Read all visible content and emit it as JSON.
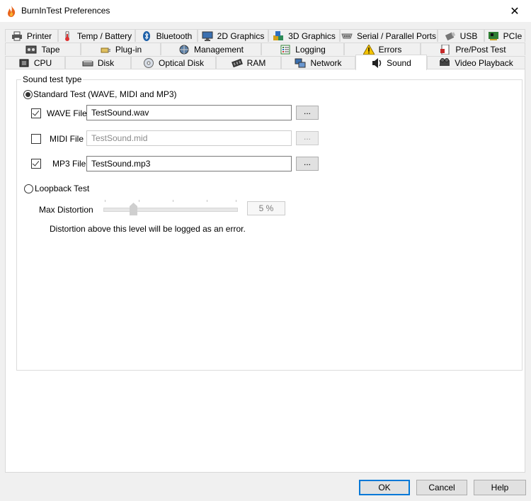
{
  "window": {
    "title": "BurnInTest Preferences",
    "close_glyph": "✕"
  },
  "tabs": {
    "row1": [
      {
        "label": "Printer",
        "icon": "printer-icon"
      },
      {
        "label": "Temp / Battery",
        "icon": "thermometer-icon"
      },
      {
        "label": "Bluetooth",
        "icon": "bluetooth-icon"
      },
      {
        "label": "2D Graphics",
        "icon": "monitor-icon"
      },
      {
        "label": "3D Graphics",
        "icon": "cubes-icon"
      },
      {
        "label": "Serial / Parallel Ports",
        "icon": "port-icon"
      },
      {
        "label": "USB",
        "icon": "usb-icon"
      },
      {
        "label": "PCIe",
        "icon": "pcie-card-icon"
      }
    ],
    "row2": [
      {
        "label": "Tape",
        "icon": "tape-icon"
      },
      {
        "label": "Plug-in",
        "icon": "plugin-icon"
      },
      {
        "label": "Management",
        "icon": "network-globe-icon"
      },
      {
        "label": "Logging",
        "icon": "log-list-icon"
      },
      {
        "label": "Errors",
        "icon": "warning-icon"
      },
      {
        "label": "Pre/Post Test",
        "icon": "document-icon"
      }
    ],
    "row3": [
      {
        "label": "CPU",
        "icon": "cpu-icon"
      },
      {
        "label": "Disk",
        "icon": "disk-drive-icon"
      },
      {
        "label": "Optical Disk",
        "icon": "optical-disk-icon"
      },
      {
        "label": "RAM",
        "icon": "ram-icon"
      },
      {
        "label": "Network",
        "icon": "network-icon"
      },
      {
        "label": "Sound",
        "icon": "speaker-icon",
        "active": true
      },
      {
        "label": "Video Playback",
        "icon": "film-icon"
      }
    ]
  },
  "sound": {
    "group_title": "Sound test type",
    "standard_label": "Standard Test (WAVE, MIDI and MP3)",
    "standard_selected": true,
    "wave": {
      "label": "WAVE File",
      "checked": true,
      "value": "TestSound.wav",
      "browse": "..."
    },
    "midi": {
      "label": "MIDI File",
      "checked": false,
      "value": "TestSound.mid",
      "browse": "...",
      "disabled": true
    },
    "mp3": {
      "label": "MP3 File",
      "checked": true,
      "value": "TestSound.mp3",
      "browse": "..."
    },
    "loopback_label": "Loopback Test",
    "loopback_selected": false,
    "distortion_label": "Max Distortion",
    "distortion_value": "5 %",
    "distortion_level_fraction": 0.2,
    "distortion_note": "Distortion above this level will be logged as an error."
  },
  "buttons": {
    "ok": "OK",
    "cancel": "Cancel",
    "help": "Help"
  },
  "colors": {
    "accent": "#0078d7",
    "icon_flame": "#e8641c"
  }
}
